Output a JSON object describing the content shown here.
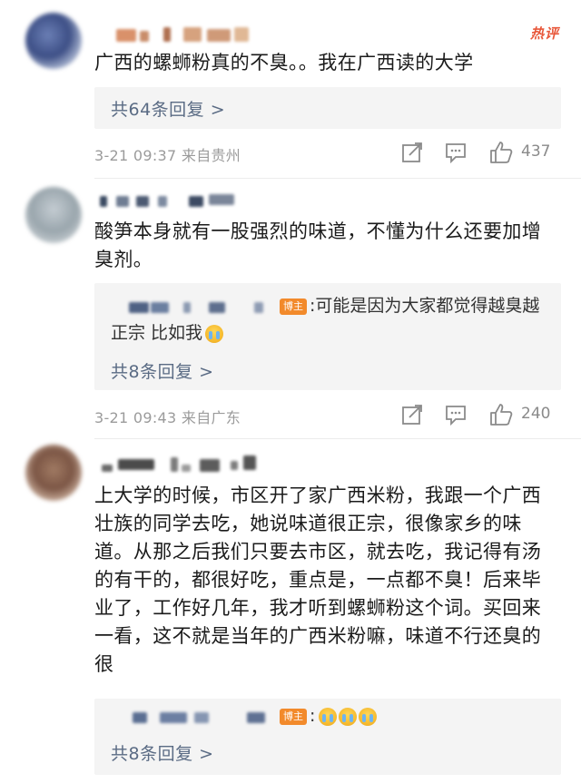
{
  "comments": [
    {
      "text": "广西的螺蛳粉真的不臭。。我在广西读的大学",
      "badge": "热评",
      "reply_count": "共64条回复 >",
      "meta": "3-21 09:37 来自贵州",
      "likes": "437"
    },
    {
      "text": "酸笋本身就有一股强烈的味道，不懂为什么还要加增臭剂。",
      "reply_badge": "博主",
      "reply_text": ":可能是因为大家都觉得越臭越正宗 比如我",
      "reply_count": "共8条回复 >",
      "meta": "3-21 09:43 来自广东",
      "likes": "240"
    },
    {
      "text": "上大学的时候，市区开了家广西米粉，我跟一个广西壮族的同学去吃，她说味道很正宗，很像家乡的味道。从那之后我们只要去市区，就去吃，我记得有汤的有干的，都很好吃，重点是，一点都不臭！后来毕业了，工作好几年，我才听到螺蛳粉这个词。买回来一看，这不就是当年的广西米粉嘛，味道不行还臭的很",
      "reply_badge": "博主",
      "reply_colon": ":",
      "reply_count": "共8条回复 >"
    }
  ],
  "icons": {
    "share": "share-icon",
    "comment": "comment-icon",
    "like": "thumbs-up-icon",
    "emoji": "crying-face-emoji"
  },
  "colors": {
    "link": "#5a6b84",
    "hot": "#e8573a",
    "badge": "#f28a2b",
    "meta": "#9b9b9b"
  }
}
